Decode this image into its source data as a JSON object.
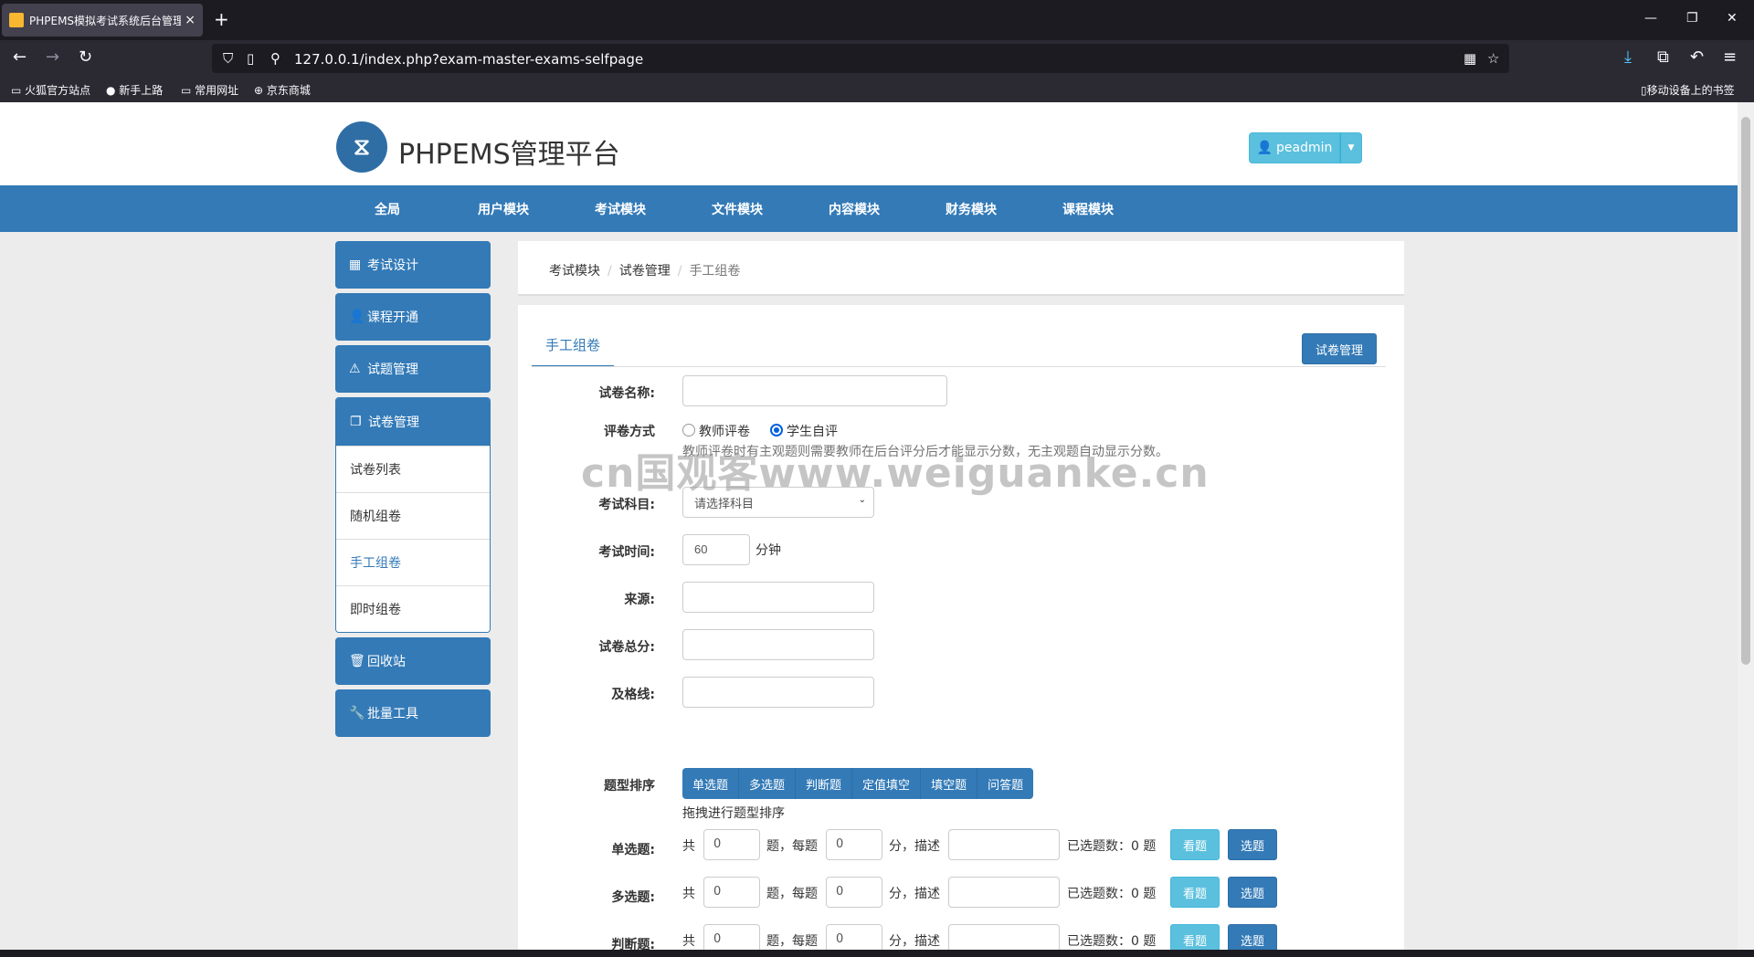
{
  "browser": {
    "tab_title": "PHPEMS模拟考试系统后台管理",
    "tab_close": "×",
    "new_tab": "+",
    "url": "127.0.0.1/index.php?exam-master-exams-selfpage",
    "win_min": "—",
    "win_max": "❐",
    "win_close": "✕",
    "bookmarks": [
      "火狐官方站点",
      "新手上路",
      "常用网址",
      "京东商城"
    ],
    "mobile_bookmarks": "移动设备上的书签"
  },
  "header": {
    "brand": "PHPEMS管理平台",
    "user": "peadmin"
  },
  "mainnav": [
    "全局",
    "用户模块",
    "考试模块",
    "文件模块",
    "内容模块",
    "财务模块",
    "课程模块"
  ],
  "sidebar": {
    "items": [
      {
        "label": "考试设计",
        "icon": "grid-icon"
      },
      {
        "label": "课程开通",
        "icon": "user-icon"
      },
      {
        "label": "试题管理",
        "icon": "flask-icon"
      },
      {
        "label": "试卷管理",
        "icon": "copy-icon"
      }
    ],
    "sub": [
      "试卷列表",
      "随机组卷",
      "手工组卷",
      "即时组卷"
    ],
    "bottom": [
      {
        "label": "回收站",
        "icon": "trash-icon"
      },
      {
        "label": "批量工具",
        "icon": "wrench-icon"
      }
    ]
  },
  "breadcrumb": [
    "考试模块",
    "试卷管理",
    "手工组卷"
  ],
  "panel": {
    "tab": "手工组卷",
    "manage_button": "试卷管理"
  },
  "form": {
    "name_label": "试卷名称:",
    "grading_label": "评卷方式",
    "grading_opt1": "教师评卷",
    "grading_opt2": "学生自评",
    "grading_help": "教师评卷时有主观题则需要教师在后台评分后才能显示分数，无主观题自动显示分数。",
    "subject_label": "考试科目:",
    "subject_value": "请选择科目",
    "time_label": "考试时间:",
    "time_value": "60",
    "time_unit": "分钟",
    "source_label": "来源:",
    "total_label": "试卷总分:",
    "pass_label": "及格线:",
    "order_label": "题型排序",
    "types": [
      "单选题",
      "多选题",
      "判断题",
      "定值填空",
      "填空题",
      "问答题"
    ],
    "order_help": "拖拽进行题型排序",
    "q_rows": [
      {
        "label": "单选题:",
        "count": "0",
        "score": "0",
        "selected": "0"
      },
      {
        "label": "多选题:",
        "count": "0",
        "score": "0",
        "selected": "0"
      },
      {
        "label": "判断题:",
        "count": "0",
        "score": "0",
        "selected": "0"
      }
    ],
    "q_text_total": "共",
    "q_text_each": "题，每题",
    "q_text_desc": "分，描述",
    "q_text_selected": "已选题数：",
    "q_text_unit": "题",
    "btn_view": "看题",
    "btn_pick": "选题"
  },
  "watermark": "cn国观客www.weiguanke.cn"
}
